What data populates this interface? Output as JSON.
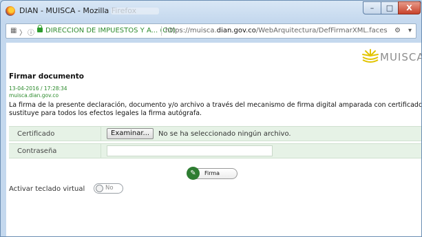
{
  "window": {
    "title": "DIAN - MUISCA - Mozilla Firefox",
    "controls": {
      "minimize": "–",
      "maximize": "□",
      "close": "X"
    }
  },
  "address_bar": {
    "site_identity": "DIRECCION DE IMPUESTOS Y A... (CO)",
    "url_prefix": "https://muisca.",
    "url_domain": "dian.gov.co",
    "url_path": "/WebArquitectura/DefFirmarXML.faces"
  },
  "logo": {
    "text": "MUISCA"
  },
  "document": {
    "title": "Firmar documento",
    "date": "13-04-2016 / 17:28:34",
    "site": "muisca.dian.gov.co",
    "description_line1": "La firma de la presente declaración, documento y/o archivo a través del mecanismo de firma digital amparada con certificado digital",
    "description_line2": "sustituye para todos los efectos legales la firma autógrafa."
  },
  "form": {
    "certificate_label": "Certificado",
    "browse_button": "Examinar...",
    "file_status": "No se ha seleccionado ningún archivo.",
    "password_label": "Contraseña",
    "password_value": "",
    "sign_button": "Firma"
  },
  "virtual_keyboard": {
    "label": "Activar teclado virtual",
    "toggle_state": "No"
  },
  "colors": {
    "form_row_bg": "#e6f2e6",
    "accent_green": "#2a8a2a",
    "window_frame": "#c4d8ee"
  }
}
